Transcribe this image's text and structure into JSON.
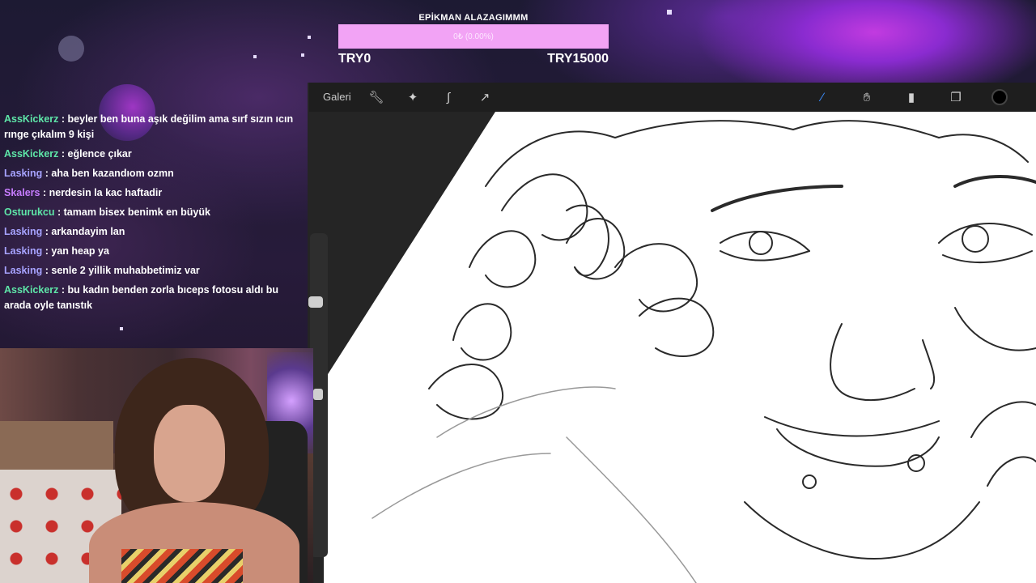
{
  "goal": {
    "title": "EPİKMAN ALAZAGIMMM",
    "progress_text": "0₺ (0.00%)",
    "progress_fraction": 0.0,
    "min_label": "TRY0",
    "max_label": "TRY15000",
    "bar_color": "#f2a3f5"
  },
  "chat": {
    "messages": [
      {
        "user": "AssKickerz",
        "color": "#5ee6a8",
        "text": ": beyler ben buna aşık değilim ama sırf sızın ıcın rınge çıkalım 9 kişi"
      },
      {
        "user": "AssKickerz",
        "color": "#5ee6a8",
        "text": ": eğlence çıkar"
      },
      {
        "user": "Lasking",
        "color": "#a7a3ff",
        "text": ": aha ben kazandıom ozmn"
      },
      {
        "user": "Skalers",
        "color": "#c77dff",
        "text": ": nerdesin la kac haftadir"
      },
      {
        "user": "Osturukcu",
        "color": "#5ee6a8",
        "text": ": tamam bisex benimk en büyük"
      },
      {
        "user": "Lasking",
        "color": "#a7a3ff",
        "text": ": arkandayim lan"
      },
      {
        "user": "Lasking",
        "color": "#a7a3ff",
        "text": ": yan heap ya"
      },
      {
        "user": "Lasking",
        "color": "#a7a3ff",
        "text": ": senle 2 yillik muhabbetimiz var"
      },
      {
        "user": "AssKickerz",
        "color": "#5ee6a8",
        "text": ": bu kadın benden zorla bıceps fotosu aldı bu arada oyle tanıstık"
      }
    ]
  },
  "toolbar": {
    "gallery_label": "Galeri",
    "left_icons": [
      "wrench-icon",
      "magic-wand-icon",
      "selection-icon",
      "transform-arrow-icon"
    ],
    "right_icons": [
      "brush-icon",
      "smudge-icon",
      "eraser-icon",
      "layers-icon",
      "color-swatch-icon"
    ],
    "active_tool_color": "#3a8dff",
    "current_color": "#000000"
  }
}
